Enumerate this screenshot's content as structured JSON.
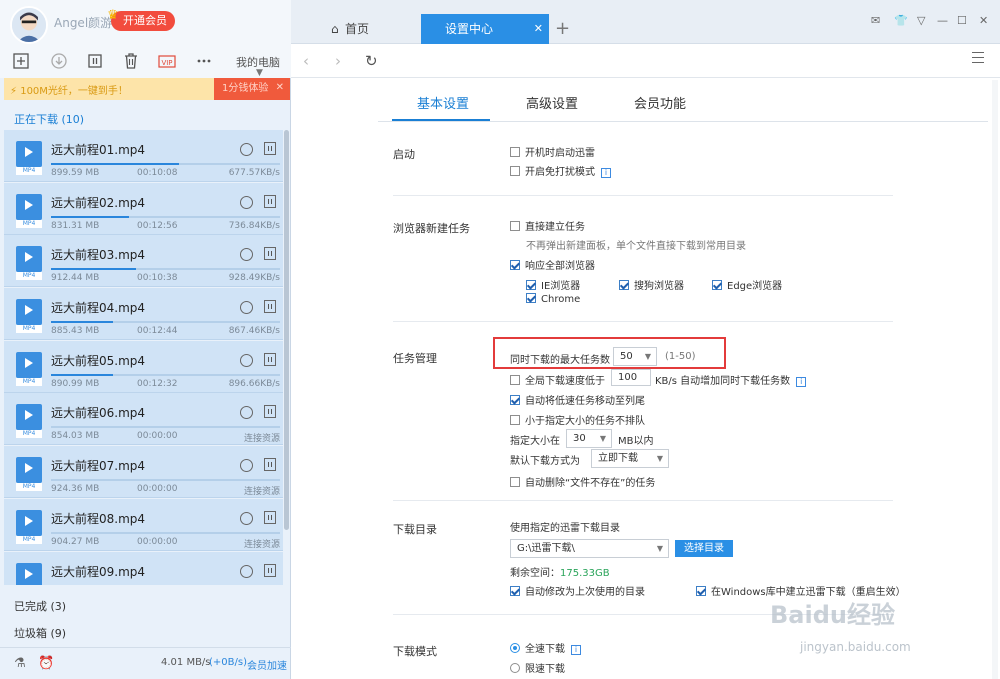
{
  "user": {
    "name": "Angel颜游",
    "vip_label": "开通会员"
  },
  "toolbar": {
    "device_label": "我的电脑",
    "vip_icon_text": "VIP"
  },
  "banner": {
    "text": "100M光纤，一键到手！",
    "button": "1分钱体验"
  },
  "downloading": {
    "header": "正在下载 (10)",
    "items": [
      {
        "name": "远大前程01.mp4",
        "size": "899.59 MB",
        "time": "00:10:08",
        "speed": "677.57KB/s",
        "progress": 0.56,
        "fmt": "MP4"
      },
      {
        "name": "远大前程02.mp4",
        "size": "831.31 MB",
        "time": "00:12:56",
        "speed": "736.84KB/s",
        "progress": 0.34,
        "fmt": "MP4"
      },
      {
        "name": "远大前程03.mp4",
        "size": "912.44 MB",
        "time": "00:10:38",
        "speed": "928.49KB/s",
        "progress": 0.37,
        "fmt": "MP4"
      },
      {
        "name": "远大前程04.mp4",
        "size": "885.43 MB",
        "time": "00:12:44",
        "speed": "867.46KB/s",
        "progress": 0.27,
        "fmt": "MP4"
      },
      {
        "name": "远大前程05.mp4",
        "size": "890.99 MB",
        "time": "00:12:32",
        "speed": "896.66KB/s",
        "progress": 0.27,
        "fmt": "MP4"
      },
      {
        "name": "远大前程06.mp4",
        "size": "854.03 MB",
        "time": "00:00:00",
        "speed": "连接资源",
        "progress": 0.0,
        "fmt": "MP4"
      },
      {
        "name": "远大前程07.mp4",
        "size": "924.36 MB",
        "time": "00:00:00",
        "speed": "连接资源",
        "progress": 0.0,
        "fmt": "MP4"
      },
      {
        "name": "远大前程08.mp4",
        "size": "904.27 MB",
        "time": "00:00:00",
        "speed": "连接资源",
        "progress": 0.0,
        "fmt": "MP4"
      },
      {
        "name": "远大前程09.mp4",
        "size": "",
        "time": "",
        "speed": "",
        "progress": 0.0,
        "fmt": "MP4"
      }
    ]
  },
  "completed": {
    "header": "已完成 (3)"
  },
  "trash": {
    "header": "垃圾箱 (9)"
  },
  "footer": {
    "speed": "4.01 MB/s",
    "speed_up": "(+0B/s)",
    "accel": "会员加速"
  },
  "tabs": {
    "home": "首页",
    "settings": "设置中心"
  },
  "settings_tabs": {
    "basic": "基本设置",
    "advanced": "高级设置",
    "vip": "会员功能"
  },
  "startup": {
    "title": "启动",
    "auto_start": "开机时启动迅雷",
    "no_disturb": "开启免打扰模式"
  },
  "browser": {
    "title": "浏览器新建任务",
    "direct": "直接建立任务",
    "direct_hint": "不再弹出新建面板，单个文件直接下载到常用目录",
    "respond_all": "响应全部浏览器",
    "ie": "IE浏览器",
    "sogou": "搜狗浏览器",
    "edge": "Edge浏览器",
    "chrome": "Chrome"
  },
  "task": {
    "title": "任务管理",
    "max_label": "同时下载的最大任务数",
    "max_value": "50",
    "max_range": "(1-50)",
    "speed_low_label": "全局下载速度低于",
    "speed_low_value": "100",
    "speed_low_suffix": "KB/s 自动增加同时下载任务数",
    "move_slow": "自动将低速任务移动至列尾",
    "small_no_queue": "小于指定大小的任务不排队",
    "size_label": "指定大小在",
    "size_value": "30",
    "size_suffix": "MB以内",
    "default_mode_label": "默认下载方式为",
    "default_mode_value": "立即下载",
    "auto_delete": "自动删除“文件不存在”的任务"
  },
  "dir": {
    "title": "下载目录",
    "use_label": "使用指定的迅雷下载目录",
    "path": "G:\\迅雷下载\\",
    "choose": "选择目录",
    "free_label": "剩余空间：",
    "free_value": "175.33GB",
    "auto_change": "自动修改为上次使用的目录",
    "win_lib": "在Windows库中建立迅雷下载（重启生效）"
  },
  "mode": {
    "title": "下载模式",
    "full": "全速下载",
    "limited": "限速下载"
  },
  "watermark": {
    "main": "Baidu经验",
    "sub": "jingyan.baidu.com"
  }
}
